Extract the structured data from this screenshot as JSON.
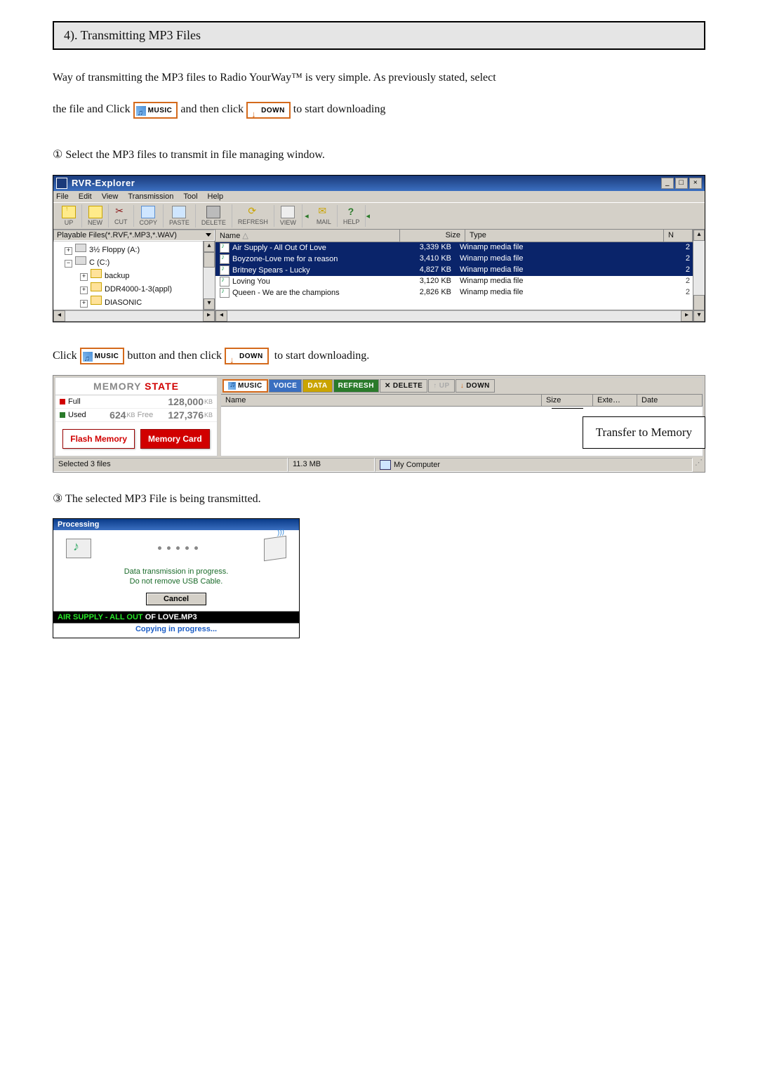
{
  "section": {
    "heading": "4). Transmitting MP3 Files"
  },
  "intro": {
    "line1_a": "Way of transmitting the MP3 files to Radio YourWay™ is very simple. As previously stated, select",
    "line2_a": "the file and Click",
    "line2_b": "and then click",
    "line2_c": "to start downloading"
  },
  "buttons": {
    "music": "MUSIC",
    "down": "DOWN"
  },
  "steps": {
    "s1": "①  Select the MP3 files to transmit in file managing window.",
    "s2_a": "Click",
    "s2_b": "button and then click",
    "s2_c": "to start downloading.",
    "s3": "③  The selected MP3 File is being transmitted."
  },
  "rvr": {
    "title": "RVR-Explorer",
    "sys": {
      "min": "_",
      "max": "□",
      "close": "×"
    },
    "menu": [
      "File",
      "Edit",
      "View",
      "Transmission",
      "Tool",
      "Help"
    ],
    "toolbar": [
      "UP",
      "NEW",
      "CUT",
      "COPY",
      "PASTE",
      "DELETE",
      "REFRESH",
      "VIEW",
      "MAIL",
      "HELP"
    ],
    "filter": "Playable Files(*.RVF,*.MP3,*.WAV)",
    "tree": {
      "floppy": "3½ Floppy (A:)",
      "c": "C (C:)",
      "backup": "backup",
      "ddr": "DDR4000-1-3(appl)",
      "diasonic": "DIASONIC"
    },
    "cols": {
      "name": "Name",
      "size": "Size",
      "type": "Type",
      "extra": "N"
    },
    "rows": [
      {
        "name": "Air Supply - All Out Of Love",
        "size": "3,339 KB",
        "type": "Winamp media file",
        "n": "2",
        "sel": true
      },
      {
        "name": "Boyzone-Love me for a reason",
        "size": "3,410 KB",
        "type": "Winamp media file",
        "n": "2",
        "sel": true
      },
      {
        "name": "Britney Spears - Lucky",
        "size": "4,827 KB",
        "type": "Winamp media file",
        "n": "2",
        "sel": true
      },
      {
        "name": "Loving You",
        "size": "3,120 KB",
        "type": "Winamp media file",
        "n": "2",
        "sel": false
      },
      {
        "name": "Queen - We are the champions",
        "size": "2,826 KB",
        "type": "Winamp media file",
        "n": "2",
        "sel": false
      }
    ]
  },
  "memstate": {
    "title_a": "MEMORY ",
    "title_b": "STATE",
    "full_lbl": "Full",
    "full_val": "128,000",
    "full_unit": "KB",
    "used_lbl": "Used",
    "used_val": "624",
    "used_unit": "KB",
    "free_lbl": "Free",
    "free_val": "127,376",
    "free_unit": "KB",
    "tab_flash": "Flash Memory",
    "tab_card": "Memory Card"
  },
  "panel2": {
    "tabs": [
      "MUSIC",
      "VOICE",
      "DATA",
      "REFRESH",
      "DELETE",
      "UP",
      "DOWN"
    ],
    "cols": {
      "name": "Name",
      "size": "Size",
      "ext": "Exte…",
      "date": "Date"
    },
    "callout": "Transfer to Memory",
    "status_left": "Selected 3 files",
    "status_size": "11.3 MB",
    "status_loc": "My Computer"
  },
  "dlg": {
    "title": "Processing",
    "msg1": "Data transmission in progress.",
    "msg2": "Do not remove USB Cable.",
    "cancel": "Cancel",
    "file_done": "AIR SUPPLY - ALL OUT ",
    "file_rest": "OF LOVE.MP3",
    "copying": "Copying in progress..."
  }
}
